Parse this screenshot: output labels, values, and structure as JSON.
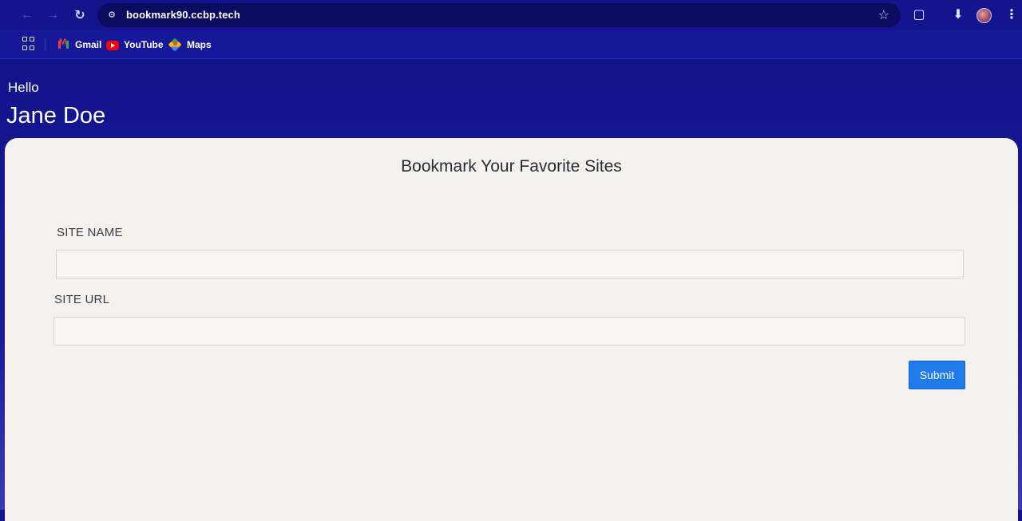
{
  "browser": {
    "url": "bookmark90.ccbp.tech",
    "bookmarks": [
      {
        "label": "Gmail",
        "icon": "gmail-icon"
      },
      {
        "label": "YouTube",
        "icon": "youtube-icon"
      },
      {
        "label": "Maps",
        "icon": "maps-icon"
      }
    ]
  },
  "header": {
    "greeting": "Hello",
    "username": "Jane Doe"
  },
  "form": {
    "title": "Bookmark Your Favorite Sites",
    "site_name_label": "SITE NAME",
    "site_name_value": "",
    "site_url_label": "SITE URL",
    "site_url_value": "",
    "submit_label": "Submit"
  },
  "colors": {
    "header_background": "#14148e",
    "card_background": "#f4f2ef",
    "submit_button": "#1f7bea"
  }
}
